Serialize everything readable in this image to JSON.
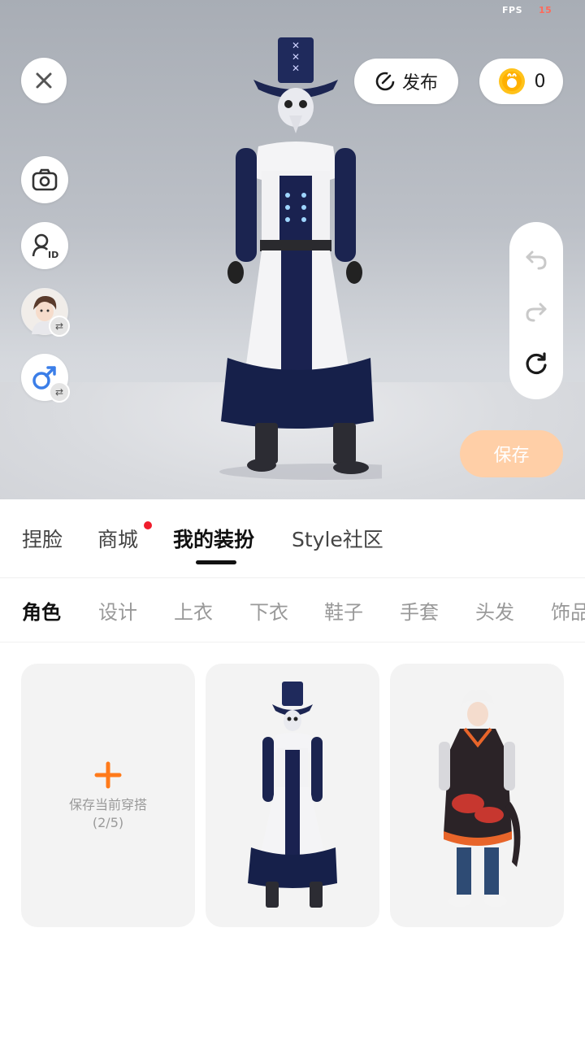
{
  "header": {
    "fps_label": "FPS",
    "fps_value": "15",
    "publish_label": "发布",
    "coins": "0",
    "save_label": "保存"
  },
  "main_tabs": [
    {
      "label": "捏脸"
    },
    {
      "label": "商城"
    },
    {
      "label": "我的装扮"
    },
    {
      "label": "Style社区"
    }
  ],
  "sub_tabs": [
    {
      "label": "角色"
    },
    {
      "label": "设计"
    },
    {
      "label": "上衣"
    },
    {
      "label": "下衣"
    },
    {
      "label": "鞋子"
    },
    {
      "label": "手套"
    },
    {
      "label": "头发"
    },
    {
      "label": "饰品"
    }
  ],
  "outfits": {
    "add_label": "保存当前穿搭",
    "add_count": "(2/5)"
  },
  "colors": {
    "accent_orange": "#ff7a1a",
    "save_disabled": "#ffcfa7",
    "notify_red": "#f01c2c",
    "male_blue": "#3b7ee8"
  }
}
